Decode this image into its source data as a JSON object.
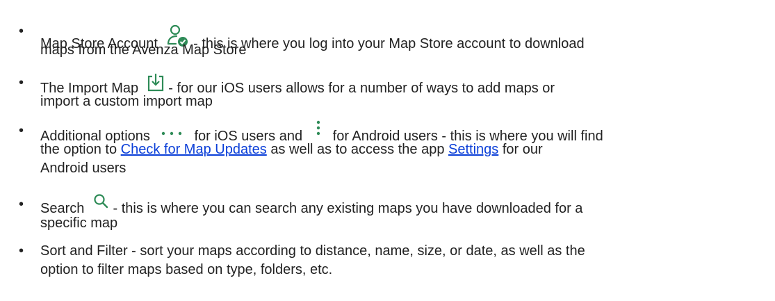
{
  "items": [
    {
      "lead": "Map Store Account",
      "icon": "account-icon",
      "rest": " - this is where you log into your Map Store account to download",
      "line2": "maps from the Avenza Map Store"
    },
    {
      "lead": "The Import Map",
      "icon": "import-icon",
      "rest": " - for our iOS users allows for a number of ways to add maps or",
      "line2": "import a custom import map"
    },
    {
      "lead": "Additional options",
      "icon_ios": "more-horizontal-icon",
      "mid": "for iOS users and",
      "icon_android": "more-vertical-icon",
      "rest": "for Android users - this is where you will find",
      "line2_pre": "the option to ",
      "link1": "Check for Map Updates",
      "line2_mid": " as well as to access the app ",
      "link2": "Settings",
      "line2_post": " for our",
      "line3": "Android users"
    },
    {
      "lead": "Search",
      "icon": "search-icon",
      "rest": " - this is where you can search any existing maps you have downloaded for a",
      "line2": "specific map"
    },
    {
      "lead": "Sort and Filter - sort your maps according to distance, name, size, or date, as well as the",
      "line2": "option to filter maps based on type, folders, etc."
    }
  ],
  "colors": {
    "text": "#222222",
    "link": "#0b3fd8",
    "icon_green": "#2e8b57"
  }
}
